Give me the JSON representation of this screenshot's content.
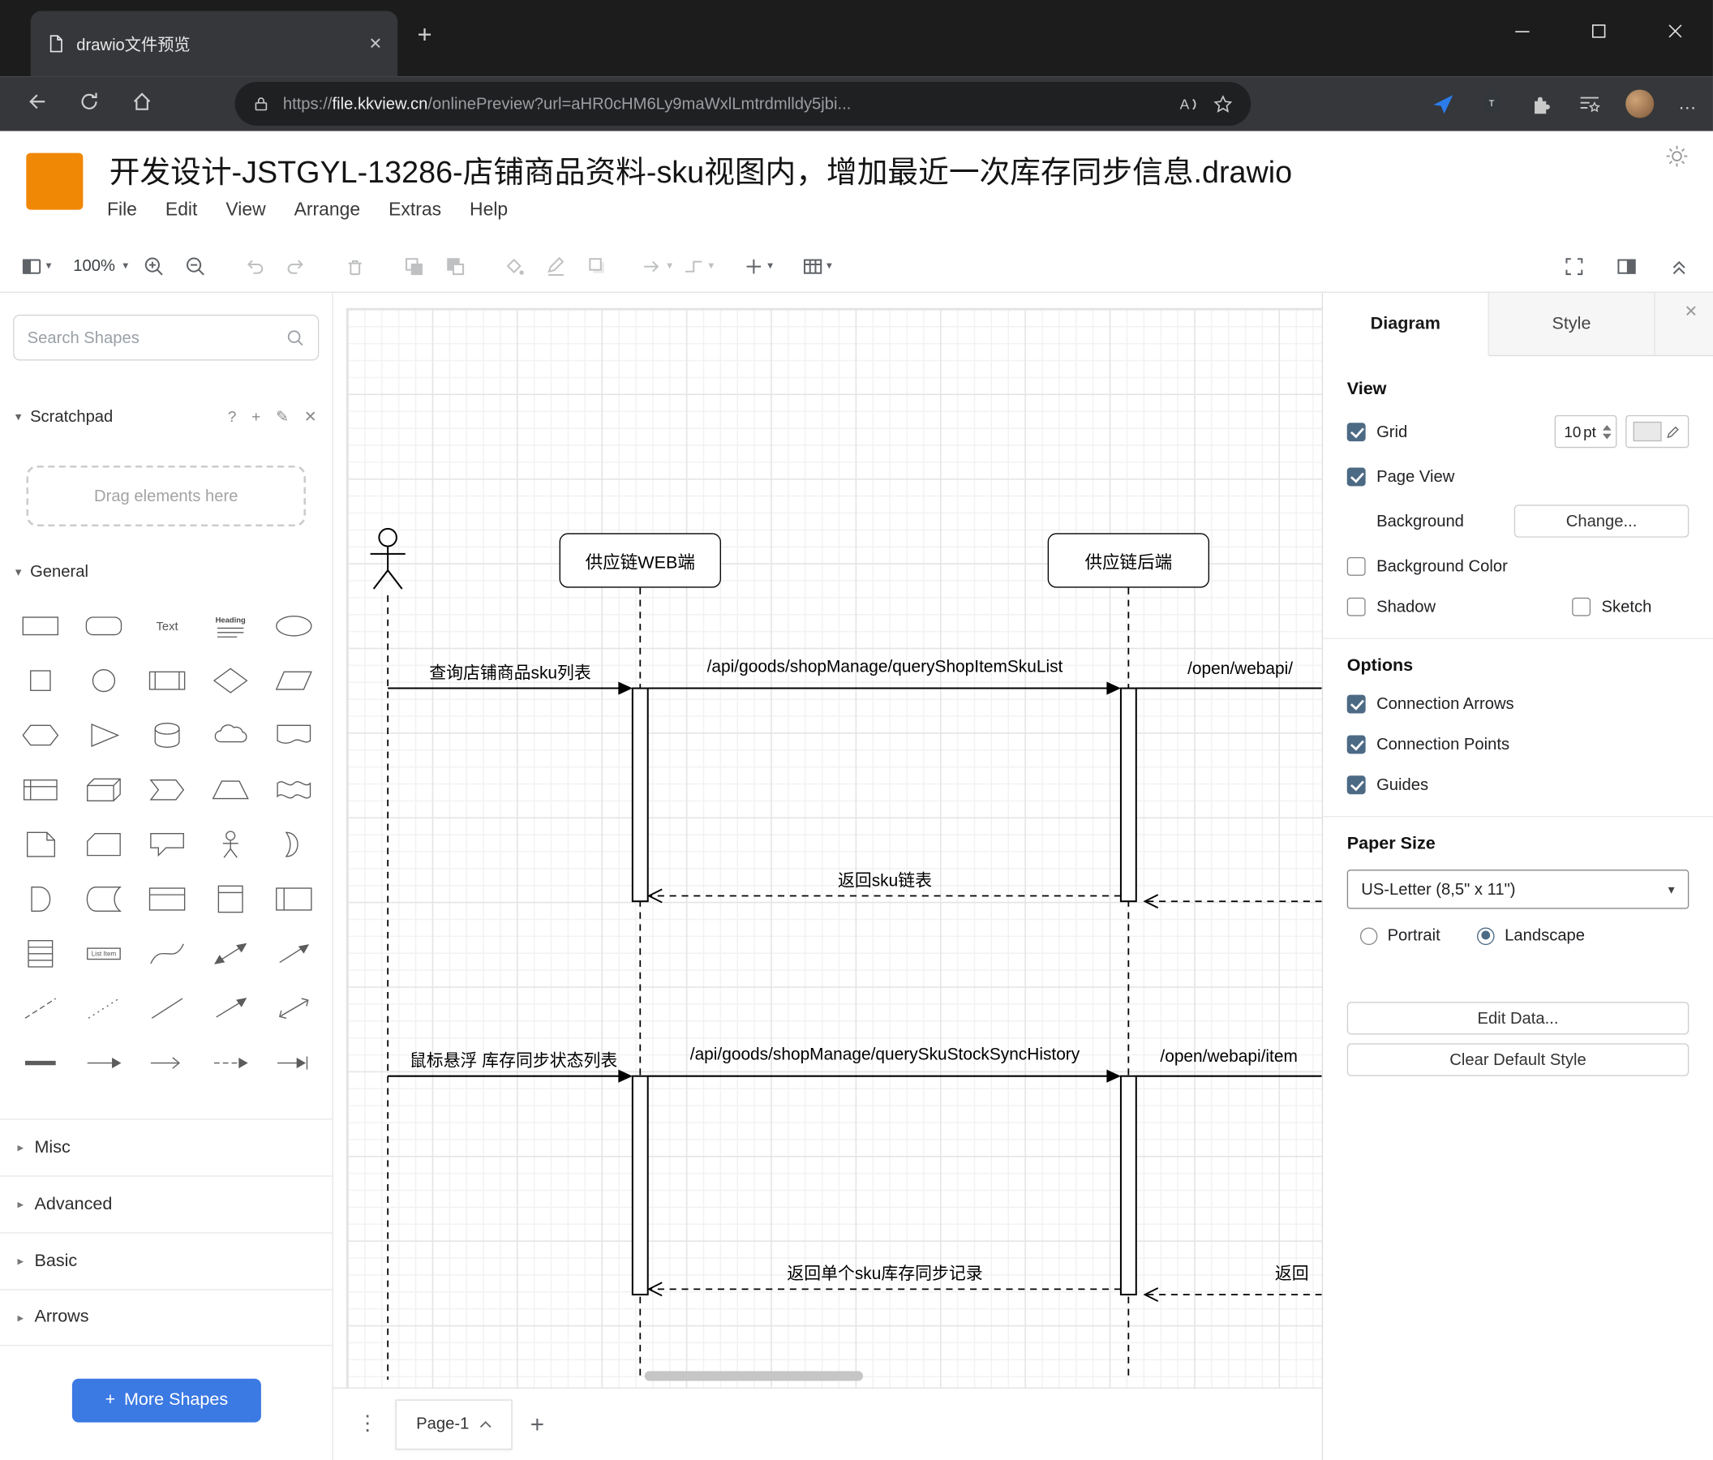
{
  "browser": {
    "tab_title": "drawio文件预览",
    "url_scheme": "https://",
    "url_domain": "file.kkview.cn",
    "url_path": "/onlinePreview?url=aHR0cHM6Ly9maWxlLmtrdmlldy5jbi...",
    "read_aloud_label": "A"
  },
  "icons": {
    "plus": "+",
    "caret_down": "▾",
    "caret_right": "▸",
    "dots_vertical": "⋮",
    "dots_more": "…",
    "close": "✕",
    "help": "?",
    "edit": "✎"
  },
  "app": {
    "title": "开发设计-JSTGYL-13286-店铺商品资料-sku视图内，增加最近一次库存同步信息.drawio",
    "menus": [
      "File",
      "Edit",
      "View",
      "Arrange",
      "Extras",
      "Help"
    ],
    "zoom": "100%"
  },
  "shapes_panel": {
    "search_placeholder": "Search Shapes",
    "scratchpad": {
      "title": "Scratchpad",
      "drop_hint": "Drag elements here"
    },
    "sections": [
      "General",
      "Misc",
      "Advanced",
      "Basic",
      "Arrows"
    ],
    "more_shapes_label": "More Shapes",
    "palette_labels": {
      "text": "Text",
      "heading": "Heading",
      "list_item": "List Item"
    },
    "palette": [
      "rectangle",
      "rounded-rectangle",
      "text",
      "heading",
      "ellipse",
      "square",
      "circle",
      "process",
      "diamond",
      "parallelogram",
      "hexagon",
      "triangle",
      "cylinder",
      "cloud",
      "document",
      "internal-storage",
      "cube",
      "step",
      "trapezoid",
      "tape",
      "note",
      "card",
      "callout",
      "actor",
      "or",
      "and",
      "data-storage",
      "container",
      "vertical-container",
      "horizontal-container",
      "list",
      "list-item",
      "curve",
      "bidirectional-arrow",
      "directional-arrow",
      "dashed-line",
      "dotted-line",
      "line",
      "diagonal-arrow",
      "diagonal-double-arrow",
      "link",
      "arrow",
      "simple-arrow",
      "dashed-arrow",
      "end-bar-arrow"
    ]
  },
  "diagram": {
    "participants": [
      {
        "label": "",
        "type": "actor"
      },
      {
        "label": "供应链WEB端",
        "type": "lifeline"
      },
      {
        "label": "供应链后端",
        "type": "lifeline"
      }
    ],
    "messages": [
      {
        "label": "查询店铺商品sku列表",
        "style": "sync"
      },
      {
        "label": "/api/goods/shopManage/queryShopItemSkuList",
        "style": "sync"
      },
      {
        "label": "/open/webapi/",
        "style": "sync"
      },
      {
        "label": "返回sku链表",
        "style": "return"
      },
      {
        "label": "鼠标悬浮 库存同步状态列表",
        "style": "sync"
      },
      {
        "label": "/api/goods/shopManage/querySkuStockSyncHistory",
        "style": "sync"
      },
      {
        "label": "/open/webapi/item",
        "style": "sync"
      },
      {
        "label": "返回单个sku库存同步记录",
        "style": "return"
      },
      {
        "label": "返回",
        "style": "return"
      }
    ]
  },
  "format_panel": {
    "tabs": [
      "Diagram",
      "Style"
    ],
    "view": {
      "heading": "View",
      "grid": "Grid",
      "grid_size": "10",
      "grid_unit": "pt",
      "page_view": "Page View",
      "background": "Background",
      "change_label": "Change...",
      "background_color": "Background Color",
      "shadow": "Shadow",
      "sketch": "Sketch"
    },
    "options": {
      "heading": "Options",
      "items": [
        "Connection Arrows",
        "Connection Points",
        "Guides"
      ]
    },
    "paper": {
      "heading": "Paper Size",
      "size": "US-Letter (8,5\" x 11\")",
      "portrait": "Portrait",
      "landscape": "Landscape"
    },
    "buttons": [
      "Edit Data...",
      "Clear Default Style"
    ]
  },
  "footer": {
    "page_tab": "Page-1"
  },
  "colors": {
    "accent_orange": "#f08705",
    "accent_blue": "#3b79e3",
    "checkbox": "#4d6a85"
  }
}
